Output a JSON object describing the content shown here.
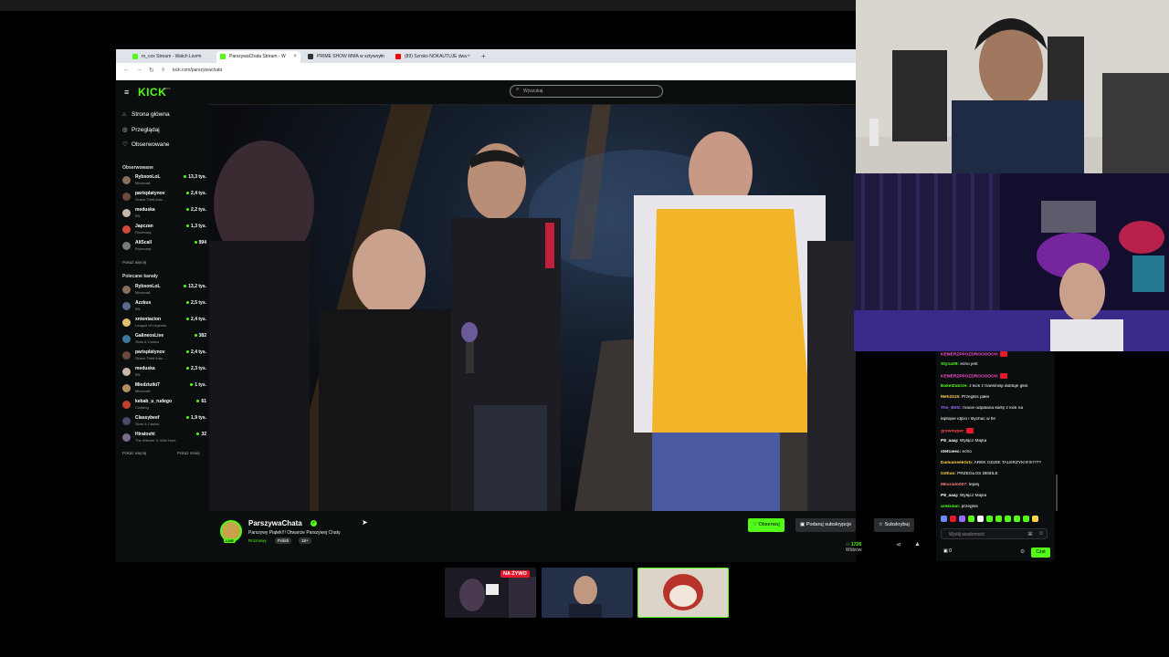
{
  "browser": {
    "tabs": [
      {
        "label": "m_cox Stream - Watch Live o",
        "active": false,
        "color": "#53fc18"
      },
      {
        "label": "ParszywaChata Stream - W",
        "active": true,
        "color": "#53fc18"
      },
      {
        "label": "PRIME SHOW MMA w sztywnym",
        "active": false,
        "color": "#333333"
      },
      {
        "label": "(89) Szroko NOKAUTUJE dwa",
        "active": false,
        "color": "#ff0000"
      }
    ],
    "new_tab": "+",
    "url": "kick.com/parszywachata"
  },
  "kick": {
    "logo": "KICK",
    "beta": "BETA",
    "search_placeholder": "Wyszukaj",
    "nav": [
      {
        "label": "Strona główna",
        "icon": "home-icon",
        "glyph": "⌂"
      },
      {
        "label": "Przeglądaj",
        "icon": "compass-icon",
        "glyph": "◎"
      },
      {
        "label": "Obserwowane",
        "icon": "heart-icon",
        "glyph": "♡"
      }
    ],
    "followed_header": "Obserwowane",
    "followed": [
      {
        "name": "RybsonLoL",
        "category": "Minecraft",
        "viewers": "13,3 tys.",
        "color": "#8a6f5a"
      },
      {
        "name": "parisplatynov",
        "category": "Grand Theft Auto ...",
        "viewers": "2,4 tys.",
        "color": "#6b4a3a"
      },
      {
        "name": "meduska",
        "category": "IRL",
        "viewers": "2,2 tys.",
        "color": "#c9b7a8"
      },
      {
        "name": "Japczan",
        "category": "Rozmowy",
        "viewers": "1,3 tys.",
        "color": "#d14a3a"
      },
      {
        "name": "AliScall",
        "category": "Rozmowy",
        "viewers": "994",
        "color": "#7a7a7a"
      }
    ],
    "followed_more": "Pokaż więcej",
    "recommended_header": "Polecane kanały",
    "recommended": [
      {
        "name": "RybsonLoL",
        "category": "Minecraft",
        "viewers": "13,2 tys.",
        "color": "#8a6f5a"
      },
      {
        "name": "Azzkus",
        "category": "IRL",
        "viewers": "2,5 tys.",
        "color": "#5a6a8a"
      },
      {
        "name": "xntentacion",
        "category": "League of Legends",
        "viewers": "2,4 tys.",
        "color": "#e0c070"
      },
      {
        "name": "GalineosLive",
        "category": "Slots & Casino",
        "viewers": "382",
        "color": "#3a7aa0"
      },
      {
        "name": "parisplatynov",
        "category": "Grand Theft Auto ...",
        "viewers": "2,4 tys.",
        "color": "#6b4a3a"
      },
      {
        "name": "meduska",
        "category": "IRL",
        "viewers": "2,3 tys.",
        "color": "#c9b7a8"
      },
      {
        "name": "Miedziutki7",
        "category": "Minecraft",
        "viewers": "1 tys.",
        "color": "#b09060"
      },
      {
        "name": "kebab_u_rudego",
        "category": "Cooking",
        "viewers": "61",
        "color": "#c04030"
      },
      {
        "name": "Classybeef",
        "category": "Slots & Casino",
        "viewers": "1,9 tys.",
        "color": "#4a4a6a"
      },
      {
        "name": "Hiratoshi",
        "category": "The Witcher 3: Wild Hunt",
        "viewers": "32",
        "color": "#7a6a8a"
      }
    ],
    "rec_more": "Pokaż więcej",
    "rec_less": "Pokaż mniej"
  },
  "stream": {
    "channel": "ParszywaChata",
    "live_badge": "LIVE",
    "title": "Parszywy Piątek!!! Otwarcie Parszywej Chaty",
    "category": "Rozmowy",
    "tags": [
      "Polish",
      "18+"
    ],
    "follow_label": "Obserwuj",
    "gift_label": "Podaruj subskrypcje",
    "subscribe_label": "Subskrybuj",
    "viewers": "1728",
    "viewers_label": "Widzów"
  },
  "chat": {
    "messages": [
      {
        "user": "KEMERZPPOZDROOOOOV:",
        "text": "",
        "color": "#ff4fd8",
        "emote": true
      },
      {
        "user": "Styna09:",
        "text": "echo jest",
        "color": "#53fc18",
        "emote": false
      },
      {
        "user": "KEMERZPPOZDROOOOOV:",
        "text": "",
        "color": "#ff4fd8",
        "emote": true
      },
      {
        "user": "BakelZabrze:",
        "text": "z kick z transmisji dubluje głos",
        "color": "#53fc18",
        "emote": false
      },
      {
        "user": "Mefi2115:",
        "text": "Przegłos pałei",
        "color": "#ffd24a",
        "emote": false
      },
      {
        "user": "The_Blitz:",
        "text": "macie odpalana kartę z kick na",
        "color": "#9b6bff",
        "emote": false
      },
      {
        "user": "",
        "text": "laptopie idjoci i słychać w tle",
        "color": "#ffffff",
        "emote": false
      },
      {
        "user": "grownuper:",
        "text": "",
        "color": "#ff4a4a",
        "emote": true
      },
      {
        "user": "P8_aaaj:",
        "text": "Wyłącz Majka",
        "color": "#ffffff",
        "emote": false
      },
      {
        "user": "stefcieec:",
        "text": "echo",
        "color": "#ffffff",
        "emote": false
      },
      {
        "user": "DamianeekGrb:",
        "text": "AREK GDZIE TALERZYK!!!!!!!!???",
        "color": "#ffd24a",
        "emote": false
      },
      {
        "user": "Githus:",
        "text": "PRZEGŁOS DEBILE",
        "color": "#ffd24a",
        "emote": false
      },
      {
        "user": "Mkuriato007:",
        "text": "lepiej",
        "color": "#ff7b7b",
        "emote": false
      },
      {
        "user": "P8_aaaj:",
        "text": "Wyłącz Majka",
        "color": "#ffffff",
        "emote": false
      },
      {
        "user": "arekulan:",
        "text": "przegłos",
        "color": "#53fc18",
        "emote": false
      }
    ],
    "input_placeholder": "Wyślij wiadomość",
    "points": "0",
    "send_label": "Czat",
    "emote_colors": [
      "#6b8cff",
      "#e5192d",
      "#9b6bff",
      "#53fc18",
      "#ffffff",
      "#53fc18",
      "#53fc18",
      "#53fc18",
      "#53fc18",
      "#53fc18",
      "#ffd24a"
    ]
  },
  "bottom": {
    "live_label": "NA ŻYWO"
  },
  "colors": {
    "brand": "#53fc18",
    "live": "#e5192d"
  }
}
